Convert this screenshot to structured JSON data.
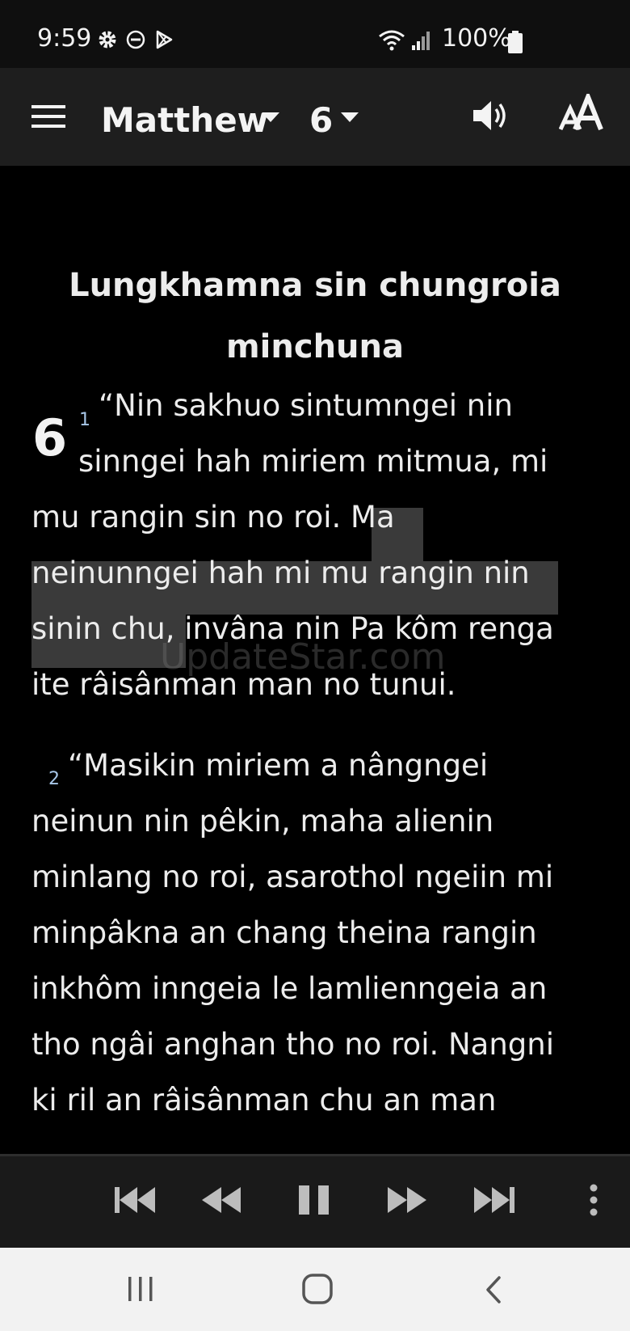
{
  "status_bar": {
    "time": "9:59",
    "battery": "100%",
    "icons": [
      "settings-icon",
      "do-not-disturb-icon",
      "play-store-icon",
      "wifi-icon",
      "signal-icon",
      "battery-icon"
    ]
  },
  "app_bar": {
    "book": "Matthew",
    "chapter": "6",
    "icons": [
      "menu-icon",
      "book-dropdown-icon",
      "chapter-dropdown-icon",
      "speaker-icon",
      "text-size-icon"
    ],
    "text_size_label": "AA"
  },
  "content": {
    "heading_line1": "Lungkhamna sin chungroia",
    "heading_line2": "minchuna",
    "chapter_number": "6",
    "watermark": "UpdateStar.com",
    "verse1": {
      "number": "1",
      "line1": "“Nin sakhuo sintumngei nin",
      "line2": "sinngei hah miriem mitmua, mi",
      "line3": "mu rangin sin no roi. Ma",
      "line4": "neinunngei hah mi mu rangin nin",
      "line5": "sinin chu, invâna nin Pa kôm renga",
      "line6": "ite râisânman man no tunui."
    },
    "verse2": {
      "number": "2",
      "line1": "“Masikin miriem a nângngei",
      "line2": "neinun nin pêkin, maha alienin",
      "line3": "minlang no roi, asarothol ngeiin mi",
      "line4": "minpâkna an chang theina rangin",
      "line5": "inkhôm inngeia le lamlienngeia an",
      "line6": "tho ngâi anghan tho no roi. Nangni",
      "line7": "ki ril an râisânman chu an man"
    },
    "highlight_color": "#3a3a3a"
  },
  "player": {
    "icons": [
      "skip-previous-icon",
      "rewind-icon",
      "pause-icon",
      "fast-forward-icon",
      "skip-next-icon",
      "more-options-icon"
    ]
  },
  "nav_bar": {
    "icons": [
      "recent-apps-icon",
      "home-icon",
      "back-icon"
    ]
  }
}
